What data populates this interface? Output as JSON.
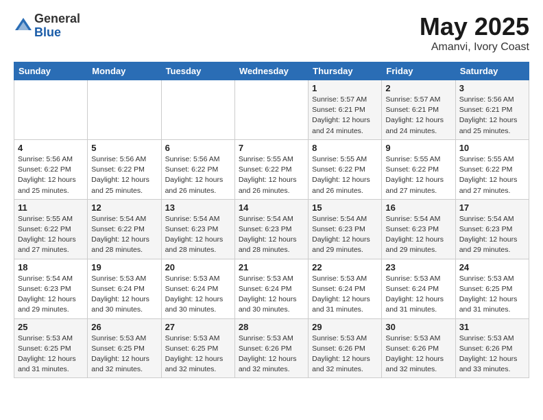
{
  "header": {
    "logo_general": "General",
    "logo_blue": "Blue",
    "month": "May 2025",
    "location": "Amanvi, Ivory Coast"
  },
  "days_of_week": [
    "Sunday",
    "Monday",
    "Tuesday",
    "Wednesday",
    "Thursday",
    "Friday",
    "Saturday"
  ],
  "weeks": [
    [
      {
        "num": "",
        "info": ""
      },
      {
        "num": "",
        "info": ""
      },
      {
        "num": "",
        "info": ""
      },
      {
        "num": "",
        "info": ""
      },
      {
        "num": "1",
        "info": "Sunrise: 5:57 AM\nSunset: 6:21 PM\nDaylight: 12 hours\nand 24 minutes."
      },
      {
        "num": "2",
        "info": "Sunrise: 5:57 AM\nSunset: 6:21 PM\nDaylight: 12 hours\nand 24 minutes."
      },
      {
        "num": "3",
        "info": "Sunrise: 5:56 AM\nSunset: 6:21 PM\nDaylight: 12 hours\nand 25 minutes."
      }
    ],
    [
      {
        "num": "4",
        "info": "Sunrise: 5:56 AM\nSunset: 6:22 PM\nDaylight: 12 hours\nand 25 minutes."
      },
      {
        "num": "5",
        "info": "Sunrise: 5:56 AM\nSunset: 6:22 PM\nDaylight: 12 hours\nand 25 minutes."
      },
      {
        "num": "6",
        "info": "Sunrise: 5:56 AM\nSunset: 6:22 PM\nDaylight: 12 hours\nand 26 minutes."
      },
      {
        "num": "7",
        "info": "Sunrise: 5:55 AM\nSunset: 6:22 PM\nDaylight: 12 hours\nand 26 minutes."
      },
      {
        "num": "8",
        "info": "Sunrise: 5:55 AM\nSunset: 6:22 PM\nDaylight: 12 hours\nand 26 minutes."
      },
      {
        "num": "9",
        "info": "Sunrise: 5:55 AM\nSunset: 6:22 PM\nDaylight: 12 hours\nand 27 minutes."
      },
      {
        "num": "10",
        "info": "Sunrise: 5:55 AM\nSunset: 6:22 PM\nDaylight: 12 hours\nand 27 minutes."
      }
    ],
    [
      {
        "num": "11",
        "info": "Sunrise: 5:55 AM\nSunset: 6:22 PM\nDaylight: 12 hours\nand 27 minutes."
      },
      {
        "num": "12",
        "info": "Sunrise: 5:54 AM\nSunset: 6:22 PM\nDaylight: 12 hours\nand 28 minutes."
      },
      {
        "num": "13",
        "info": "Sunrise: 5:54 AM\nSunset: 6:23 PM\nDaylight: 12 hours\nand 28 minutes."
      },
      {
        "num": "14",
        "info": "Sunrise: 5:54 AM\nSunset: 6:23 PM\nDaylight: 12 hours\nand 28 minutes."
      },
      {
        "num": "15",
        "info": "Sunrise: 5:54 AM\nSunset: 6:23 PM\nDaylight: 12 hours\nand 29 minutes."
      },
      {
        "num": "16",
        "info": "Sunrise: 5:54 AM\nSunset: 6:23 PM\nDaylight: 12 hours\nand 29 minutes."
      },
      {
        "num": "17",
        "info": "Sunrise: 5:54 AM\nSunset: 6:23 PM\nDaylight: 12 hours\nand 29 minutes."
      }
    ],
    [
      {
        "num": "18",
        "info": "Sunrise: 5:54 AM\nSunset: 6:23 PM\nDaylight: 12 hours\nand 29 minutes."
      },
      {
        "num": "19",
        "info": "Sunrise: 5:53 AM\nSunset: 6:24 PM\nDaylight: 12 hours\nand 30 minutes."
      },
      {
        "num": "20",
        "info": "Sunrise: 5:53 AM\nSunset: 6:24 PM\nDaylight: 12 hours\nand 30 minutes."
      },
      {
        "num": "21",
        "info": "Sunrise: 5:53 AM\nSunset: 6:24 PM\nDaylight: 12 hours\nand 30 minutes."
      },
      {
        "num": "22",
        "info": "Sunrise: 5:53 AM\nSunset: 6:24 PM\nDaylight: 12 hours\nand 31 minutes."
      },
      {
        "num": "23",
        "info": "Sunrise: 5:53 AM\nSunset: 6:24 PM\nDaylight: 12 hours\nand 31 minutes."
      },
      {
        "num": "24",
        "info": "Sunrise: 5:53 AM\nSunset: 6:25 PM\nDaylight: 12 hours\nand 31 minutes."
      }
    ],
    [
      {
        "num": "25",
        "info": "Sunrise: 5:53 AM\nSunset: 6:25 PM\nDaylight: 12 hours\nand 31 minutes."
      },
      {
        "num": "26",
        "info": "Sunrise: 5:53 AM\nSunset: 6:25 PM\nDaylight: 12 hours\nand 32 minutes."
      },
      {
        "num": "27",
        "info": "Sunrise: 5:53 AM\nSunset: 6:25 PM\nDaylight: 12 hours\nand 32 minutes."
      },
      {
        "num": "28",
        "info": "Sunrise: 5:53 AM\nSunset: 6:26 PM\nDaylight: 12 hours\nand 32 minutes."
      },
      {
        "num": "29",
        "info": "Sunrise: 5:53 AM\nSunset: 6:26 PM\nDaylight: 12 hours\nand 32 minutes."
      },
      {
        "num": "30",
        "info": "Sunrise: 5:53 AM\nSunset: 6:26 PM\nDaylight: 12 hours\nand 32 minutes."
      },
      {
        "num": "31",
        "info": "Sunrise: 5:53 AM\nSunset: 6:26 PM\nDaylight: 12 hours\nand 33 minutes."
      }
    ]
  ]
}
